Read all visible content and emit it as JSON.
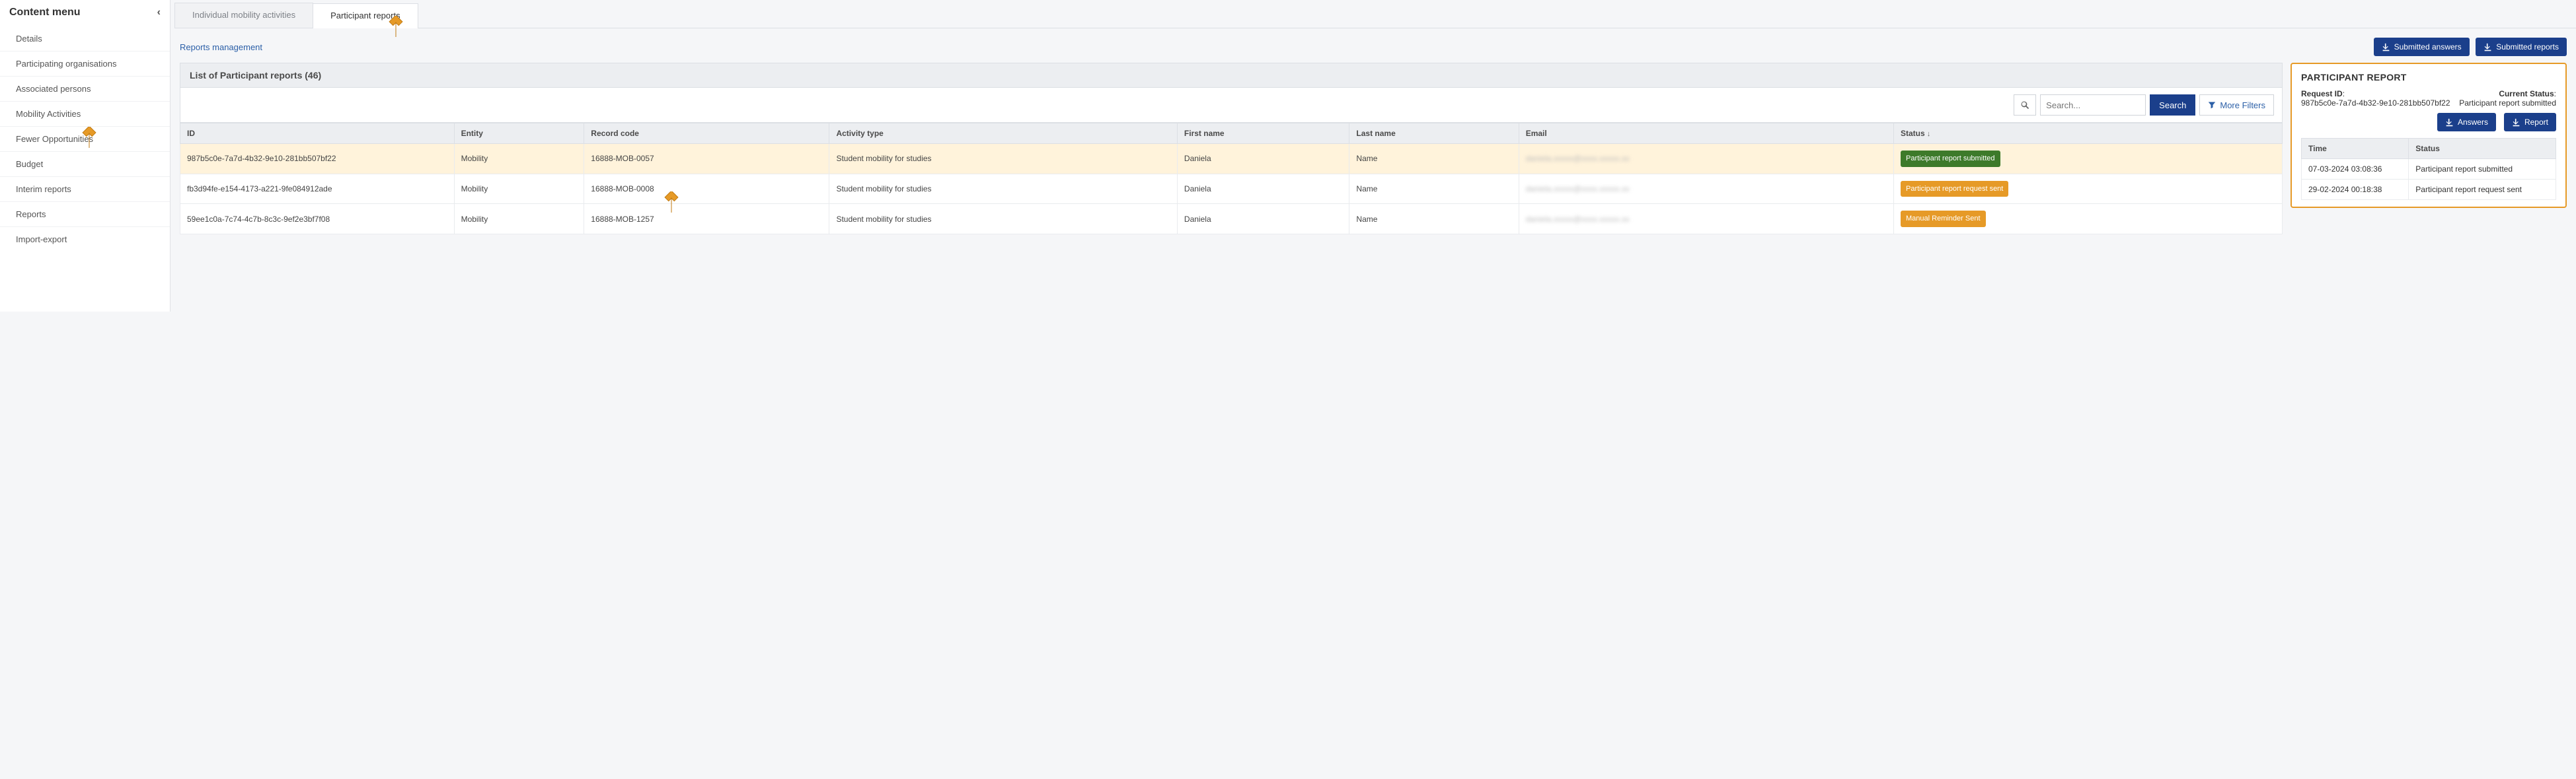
{
  "sidebar": {
    "title": "Content menu",
    "items": [
      "Details",
      "Participating organisations",
      "Associated persons",
      "Mobility Activities",
      "Fewer Opportunities",
      "Budget",
      "Interim reports",
      "Reports",
      "Import-export"
    ]
  },
  "tabs": [
    "Individual mobility activities",
    "Participant reports"
  ],
  "reports_management": "Reports management",
  "top_buttons": {
    "answers": "Submitted answers",
    "reports": "Submitted reports"
  },
  "list_title": "List of Participant reports (46)",
  "search": {
    "placeholder": "Search...",
    "button": "Search",
    "more_filters": "More Filters"
  },
  "columns": {
    "id": "ID",
    "entity": "Entity",
    "record": "Record code",
    "activity": "Activity type",
    "first": "First name",
    "last": "Last name",
    "email": "Email",
    "status": "Status"
  },
  "rows": [
    {
      "id": "987b5c0e-7a7d-4b32-9e10-281bb507bf22",
      "entity": "Mobility",
      "record": "16888-MOB-0057",
      "activity": "Student mobility for studies",
      "first": "Daniela",
      "last": "Name",
      "email": "daniela.xxxxx@xxxx.xxxxx.xx",
      "status": "Participant report submitted",
      "status_class": "status-green",
      "selected": true
    },
    {
      "id": "fb3d94fe-e154-4173-a221-9fe084912ade",
      "entity": "Mobility",
      "record": "16888-MOB-0008",
      "activity": "Student mobility for studies",
      "first": "Daniela",
      "last": "Name",
      "email": "daniela.xxxxx@xxxx.xxxxx.xx",
      "status": "Participant report request sent",
      "status_class": "status-orange",
      "selected": false
    },
    {
      "id": "59ee1c0a-7c74-4c7b-8c3c-9ef2e3bf7f08",
      "entity": "Mobility",
      "record": "16888-MOB-1257",
      "activity": "Student mobility for studies",
      "first": "Daniela",
      "last": "Name",
      "email": "daniela.xxxxx@xxxx.xxxxx.xx",
      "status": "Manual Reminder Sent",
      "status_class": "status-orange",
      "selected": false
    }
  ],
  "detail": {
    "heading": "PARTICIPANT REPORT",
    "request_id_label": "Request ID",
    "request_id": "987b5c0e-7a7d-4b32-9e10-281bb507bf22",
    "current_status_label": "Current Status",
    "current_status": "Participant report submitted",
    "answers_btn": "Answers",
    "report_btn": "Report",
    "time_col": "Time",
    "status_col": "Status",
    "history": [
      {
        "time": "07-03-2024 03:08:36",
        "status": "Participant report submitted"
      },
      {
        "time": "29-02-2024 00:18:38",
        "status": "Participant report request sent"
      }
    ]
  }
}
